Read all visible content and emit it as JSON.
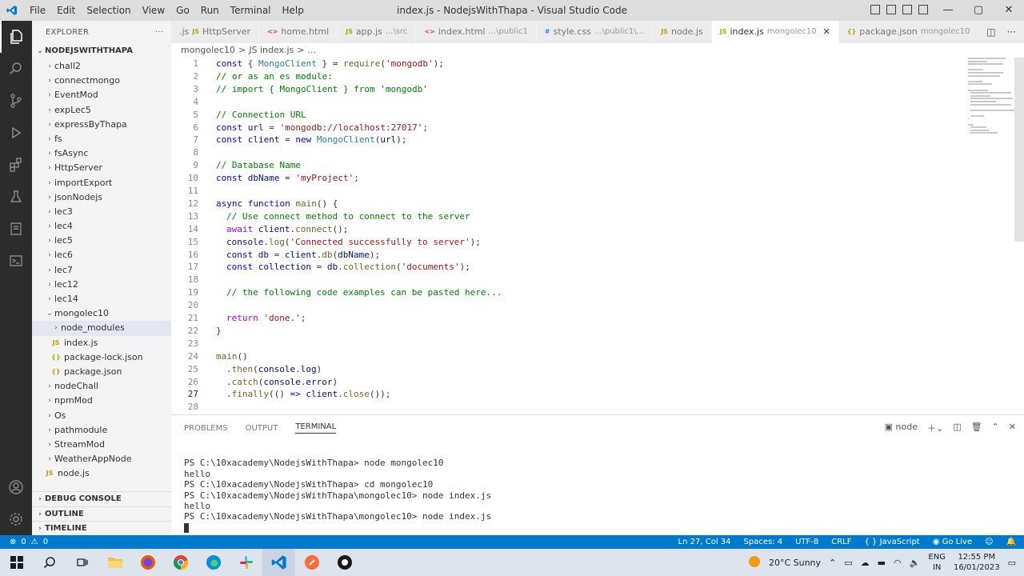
{
  "titlebar": {
    "menu": [
      "File",
      "Edit",
      "Selection",
      "View",
      "Go",
      "Run",
      "Terminal",
      "Help"
    ],
    "window_title": "index.js - NodejsWithThapa - Visual Studio Code"
  },
  "sidebar": {
    "header": "EXPLORER",
    "more": "···",
    "root": "NODEJSWITHTHAPA",
    "items": [
      {
        "label": "chall2",
        "type": "folder",
        "depth": 0,
        "open": false
      },
      {
        "label": "connectmongo",
        "type": "folder",
        "depth": 0,
        "open": false
      },
      {
        "label": "EventMod",
        "type": "folder",
        "depth": 0,
        "open": false
      },
      {
        "label": "expLec5",
        "type": "folder",
        "depth": 0,
        "open": false
      },
      {
        "label": "expressByThapa",
        "type": "folder",
        "depth": 0,
        "open": false
      },
      {
        "label": "fs",
        "type": "folder",
        "depth": 0,
        "open": false
      },
      {
        "label": "fsAsync",
        "type": "folder",
        "depth": 0,
        "open": false
      },
      {
        "label": "HttpServer",
        "type": "folder",
        "depth": 0,
        "open": false
      },
      {
        "label": "importExport",
        "type": "folder",
        "depth": 0,
        "open": false
      },
      {
        "label": "jsonNodejs",
        "type": "folder",
        "depth": 0,
        "open": false
      },
      {
        "label": "lec3",
        "type": "folder",
        "depth": 0,
        "open": false
      },
      {
        "label": "lec4",
        "type": "folder",
        "depth": 0,
        "open": false
      },
      {
        "label": "lec5",
        "type": "folder",
        "depth": 0,
        "open": false
      },
      {
        "label": "lec6",
        "type": "folder",
        "depth": 0,
        "open": false
      },
      {
        "label": "lec7",
        "type": "folder",
        "depth": 0,
        "open": false
      },
      {
        "label": "lec12",
        "type": "folder",
        "depth": 0,
        "open": false
      },
      {
        "label": "lec14",
        "type": "folder",
        "depth": 0,
        "open": false
      },
      {
        "label": "mongolec10",
        "type": "folder",
        "depth": 0,
        "open": true
      },
      {
        "label": "node_modules",
        "type": "folder",
        "depth": 1,
        "open": false,
        "selected": true
      },
      {
        "label": "index.js",
        "type": "js",
        "depth": 1
      },
      {
        "label": "package-lock.json",
        "type": "json",
        "depth": 1
      },
      {
        "label": "package.json",
        "type": "json",
        "depth": 1
      },
      {
        "label": "nodeChall",
        "type": "folder",
        "depth": 0,
        "open": false
      },
      {
        "label": "npmMod",
        "type": "folder",
        "depth": 0,
        "open": false
      },
      {
        "label": "Os",
        "type": "folder",
        "depth": 0,
        "open": false
      },
      {
        "label": "pathmodule",
        "type": "folder",
        "depth": 0,
        "open": false
      },
      {
        "label": "StreamMod",
        "type": "folder",
        "depth": 0,
        "open": false
      },
      {
        "label": "WeatherAppNode",
        "type": "folder",
        "depth": 0,
        "open": false
      },
      {
        "label": "node.js",
        "type": "js",
        "depth": 0
      }
    ],
    "panes": [
      "DEBUG CONSOLE",
      "OUTLINE",
      "TIMELINE"
    ]
  },
  "tabs": [
    {
      "icon": "JS",
      "label": "HttpServer",
      "desc": "",
      "kind": "js",
      "prefix": ".js"
    },
    {
      "icon": "<>",
      "label": "home.html",
      "desc": "",
      "kind": "html"
    },
    {
      "icon": "JS",
      "label": "app.js",
      "desc": "...\\src",
      "kind": "js"
    },
    {
      "icon": "<>",
      "label": "index.html",
      "desc": "...\\public1",
      "kind": "html"
    },
    {
      "icon": "#",
      "label": "style.css",
      "desc": "...\\public1\\...",
      "kind": "css"
    },
    {
      "icon": "JS",
      "label": "node.js",
      "desc": "",
      "kind": "js"
    },
    {
      "icon": "JS",
      "label": "index.js",
      "desc": "mongolec10",
      "kind": "js",
      "active": true
    },
    {
      "icon": "{}",
      "label": "package.json",
      "desc": "mongolec10",
      "kind": "json"
    }
  ],
  "breadcrumb": [
    "mongolec10",
    ">",
    "JS index.js",
    ">",
    "..."
  ],
  "editor": {
    "current_line": 27,
    "lines": [
      {
        "n": 1,
        "indent": 0,
        "tokens": [
          [
            "kw",
            "const"
          ],
          [
            "punc",
            " { "
          ],
          [
            "cls",
            "MongoClient"
          ],
          [
            "punc",
            " } = "
          ],
          [
            "fn",
            "require"
          ],
          [
            "punc",
            "("
          ],
          [
            "str",
            "'mongodb'"
          ],
          [
            "punc",
            ");"
          ]
        ]
      },
      {
        "n": 2,
        "indent": 0,
        "tokens": [
          [
            "cm",
            "// or as an es module:"
          ]
        ]
      },
      {
        "n": 3,
        "indent": 0,
        "tokens": [
          [
            "cm",
            "// import { MongoClient } from 'mongodb'"
          ]
        ]
      },
      {
        "n": 4,
        "indent": 0,
        "tokens": []
      },
      {
        "n": 5,
        "indent": 0,
        "tokens": [
          [
            "cm",
            "// Connection URL"
          ]
        ]
      },
      {
        "n": 6,
        "indent": 0,
        "tokens": [
          [
            "kw",
            "const"
          ],
          [
            "punc",
            " "
          ],
          [
            "var",
            "url"
          ],
          [
            "punc",
            " = "
          ],
          [
            "str",
            "'mongodb://localhost:27017'"
          ],
          [
            "punc",
            ";"
          ]
        ]
      },
      {
        "n": 7,
        "indent": 0,
        "tokens": [
          [
            "kw",
            "const"
          ],
          [
            "punc",
            " "
          ],
          [
            "var",
            "client"
          ],
          [
            "punc",
            " = "
          ],
          [
            "kw",
            "new"
          ],
          [
            "punc",
            " "
          ],
          [
            "cls",
            "MongoClient"
          ],
          [
            "punc",
            "("
          ],
          [
            "var",
            "url"
          ],
          [
            "punc",
            ");"
          ]
        ]
      },
      {
        "n": 8,
        "indent": 0,
        "tokens": []
      },
      {
        "n": 9,
        "indent": 0,
        "tokens": [
          [
            "cm",
            "// Database Name"
          ]
        ]
      },
      {
        "n": 10,
        "indent": 0,
        "tokens": [
          [
            "kw",
            "const"
          ],
          [
            "punc",
            " "
          ],
          [
            "var",
            "dbName"
          ],
          [
            "punc",
            " = "
          ],
          [
            "str",
            "'myProject'"
          ],
          [
            "punc",
            ";"
          ]
        ]
      },
      {
        "n": 11,
        "indent": 0,
        "tokens": []
      },
      {
        "n": 12,
        "indent": 0,
        "tokens": [
          [
            "kw",
            "async"
          ],
          [
            "punc",
            " "
          ],
          [
            "kw",
            "function"
          ],
          [
            "punc",
            " "
          ],
          [
            "fn",
            "main"
          ],
          [
            "punc",
            "() {"
          ]
        ]
      },
      {
        "n": 13,
        "indent": 1,
        "tokens": [
          [
            "cm",
            "// Use connect method to connect to the server"
          ]
        ]
      },
      {
        "n": 14,
        "indent": 1,
        "tokens": [
          [
            "kw2",
            "await"
          ],
          [
            "punc",
            " "
          ],
          [
            "var",
            "client"
          ],
          [
            "punc",
            "."
          ],
          [
            "fn",
            "connect"
          ],
          [
            "punc",
            "();"
          ]
        ]
      },
      {
        "n": 15,
        "indent": 1,
        "tokens": [
          [
            "var",
            "console"
          ],
          [
            "punc",
            "."
          ],
          [
            "fn",
            "log"
          ],
          [
            "punc",
            "("
          ],
          [
            "str",
            "'Connected successfully to server'"
          ],
          [
            "punc",
            ");"
          ]
        ]
      },
      {
        "n": 16,
        "indent": 1,
        "tokens": [
          [
            "kw",
            "const"
          ],
          [
            "punc",
            " "
          ],
          [
            "var",
            "db"
          ],
          [
            "punc",
            " = "
          ],
          [
            "var",
            "client"
          ],
          [
            "punc",
            "."
          ],
          [
            "fn",
            "db"
          ],
          [
            "punc",
            "("
          ],
          [
            "var",
            "dbName"
          ],
          [
            "punc",
            ");"
          ]
        ]
      },
      {
        "n": 17,
        "indent": 1,
        "tokens": [
          [
            "kw",
            "const"
          ],
          [
            "punc",
            " "
          ],
          [
            "var",
            "collection"
          ],
          [
            "punc",
            " = "
          ],
          [
            "var",
            "db"
          ],
          [
            "punc",
            "."
          ],
          [
            "fn",
            "collection"
          ],
          [
            "punc",
            "("
          ],
          [
            "str",
            "'documents'"
          ],
          [
            "punc",
            ");"
          ]
        ]
      },
      {
        "n": 18,
        "indent": 0,
        "tokens": []
      },
      {
        "n": 19,
        "indent": 1,
        "tokens": [
          [
            "cm",
            "// the following code examples can be pasted here..."
          ]
        ]
      },
      {
        "n": 20,
        "indent": 0,
        "tokens": []
      },
      {
        "n": 21,
        "indent": 1,
        "tokens": [
          [
            "kw2",
            "return"
          ],
          [
            "punc",
            " "
          ],
          [
            "str",
            "'done.'"
          ],
          [
            "punc",
            ";"
          ]
        ]
      },
      {
        "n": 22,
        "indent": 0,
        "tokens": [
          [
            "punc",
            "}"
          ]
        ]
      },
      {
        "n": 23,
        "indent": 0,
        "tokens": []
      },
      {
        "n": 24,
        "indent": 0,
        "tokens": [
          [
            "fn",
            "main"
          ],
          [
            "punc",
            "()"
          ]
        ]
      },
      {
        "n": 25,
        "indent": 1,
        "tokens": [
          [
            "punc",
            "."
          ],
          [
            "fn",
            "then"
          ],
          [
            "punc",
            "("
          ],
          [
            "var",
            "console"
          ],
          [
            "punc",
            "."
          ],
          [
            "var",
            "log"
          ],
          [
            "punc",
            ")"
          ]
        ]
      },
      {
        "n": 26,
        "indent": 1,
        "tokens": [
          [
            "punc",
            "."
          ],
          [
            "fn",
            "catch"
          ],
          [
            "punc",
            "("
          ],
          [
            "var",
            "console"
          ],
          [
            "punc",
            "."
          ],
          [
            "var",
            "error"
          ],
          [
            "punc",
            ")"
          ]
        ]
      },
      {
        "n": 27,
        "indent": 1,
        "tokens": [
          [
            "punc",
            "."
          ],
          [
            "fn",
            "finally"
          ],
          [
            "punc",
            "(() "
          ],
          [
            "kw",
            "=>"
          ],
          [
            "punc",
            " "
          ],
          [
            "var",
            "client"
          ],
          [
            "punc",
            "."
          ],
          [
            "fn",
            "close"
          ],
          [
            "punc",
            "());"
          ]
        ]
      },
      {
        "n": 28,
        "indent": 0,
        "tokens": []
      }
    ]
  },
  "panel": {
    "tabs": [
      "PROBLEMS",
      "OUTPUT",
      "TERMINAL"
    ],
    "active_tab": "TERMINAL",
    "shell": "node",
    "terminal_lines": [
      "",
      "PS C:\\10xacademy\\NodejsWithThapa> node mongolec10",
      "hello",
      "PS C:\\10xacademy\\NodejsWithThapa> cd mongolec10",
      "PS C:\\10xacademy\\NodejsWithThapa\\mongolec10> node index.js",
      "hello",
      "PS C:\\10xacademy\\NodejsWithThapa\\mongolec10> node index.js"
    ]
  },
  "statusbar": {
    "errors": "0",
    "warnings": "0",
    "position": "Ln 27, Col 34",
    "spaces": "Spaces: 4",
    "encoding": "UTF-8",
    "eol": "CRLF",
    "language": "{ } JavaScript",
    "golive": "Go Live"
  },
  "taskbar": {
    "weather": "20°C  Sunny",
    "lang_top": "ENG",
    "lang_bottom": "IN",
    "time": "12:55 PM",
    "date": "16/01/2023"
  },
  "colors": {
    "statusbar": "#007acc",
    "activitybar": "#2c2c2c",
    "sidebar": "#f3f3f3",
    "titlebar": "#dddddd"
  }
}
